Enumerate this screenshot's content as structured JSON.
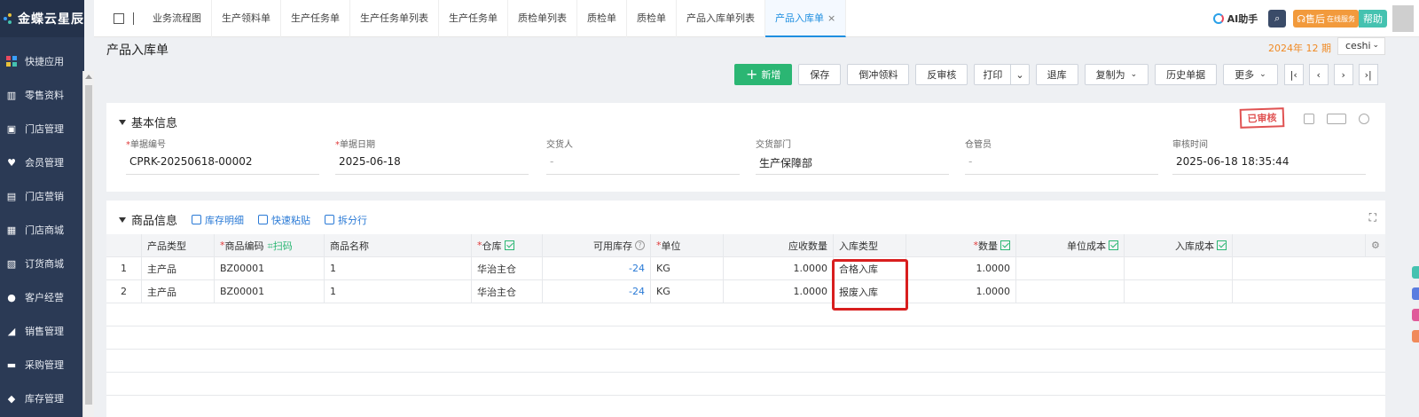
{
  "brand": {
    "logo_text": "金蝶云星辰"
  },
  "sidebar": {
    "items": [
      {
        "label": "快捷应用",
        "icon": "grid-icon"
      },
      {
        "label": "零售资料",
        "icon": "store-icon"
      },
      {
        "label": "门店管理",
        "icon": "shop-icon"
      },
      {
        "label": "会员管理",
        "icon": "heart-icon"
      },
      {
        "label": "门店营销",
        "icon": "bag-icon"
      },
      {
        "label": "门店商城",
        "icon": "mall-icon"
      },
      {
        "label": "订货商城",
        "icon": "calendar-icon"
      },
      {
        "label": "客户经营",
        "icon": "customer-icon"
      },
      {
        "label": "销售管理",
        "icon": "chart-icon"
      },
      {
        "label": "采购管理",
        "icon": "cart-icon"
      },
      {
        "label": "库存管理",
        "icon": "box-icon"
      }
    ]
  },
  "tabs": [
    {
      "label": "业务流程图"
    },
    {
      "label": "生产领料单"
    },
    {
      "label": "生产任务单"
    },
    {
      "label": "生产任务单列表"
    },
    {
      "label": "生产任务单"
    },
    {
      "label": "质检单列表"
    },
    {
      "label": "质检单"
    },
    {
      "label": "质检单"
    },
    {
      "label": "产品入库单列表"
    },
    {
      "label": "产品入库单",
      "active": true
    }
  ],
  "topright": {
    "ai_label": "AI助手",
    "service_label": "售后",
    "service_sub": "在线服务",
    "help_label": "帮助"
  },
  "page": {
    "title": "产品入库单",
    "period": "2024年 12 期",
    "user": "ceshi"
  },
  "toolbar": {
    "new": "新增",
    "save": "保存",
    "reverse": "倒冲领料",
    "unaudit": "反审核",
    "print": "打印",
    "return": "退库",
    "copy": "复制为",
    "history": "历史单据",
    "more": "更多"
  },
  "basic": {
    "title": "基本信息",
    "stamp": "已审核",
    "fields": [
      {
        "label": "单据编号",
        "required": true,
        "value": "CPRK-20250618-00002"
      },
      {
        "label": "单据日期",
        "required": true,
        "value": "2025-06-18"
      },
      {
        "label": "交货人",
        "required": false,
        "value": "-"
      },
      {
        "label": "交货部门",
        "required": false,
        "value": "生产保障部"
      },
      {
        "label": "仓管员",
        "required": false,
        "value": "-"
      },
      {
        "label": "审核时间",
        "required": false,
        "value": "2025-06-18 18:35:44"
      }
    ]
  },
  "goods": {
    "title": "商品信息",
    "links": [
      "库存明细",
      "快速粘贴",
      "拆分行"
    ],
    "scan_label": "扫码",
    "headers": {
      "type": "产品类型",
      "code": "商品编码",
      "name": "商品名称",
      "warehouse": "仓库",
      "stock": "可用库存",
      "unit": "单位",
      "recv_qty": "应收数量",
      "in_type": "入库类型",
      "qty": "数量",
      "unit_cost": "单位成本",
      "in_cost": "入库成本"
    },
    "rows": [
      {
        "no": "1",
        "type": "主产品",
        "code": "BZ00001",
        "name": "1",
        "warehouse": "华治主仓",
        "stock": "-24",
        "unit": "KG",
        "recv_qty": "1.0000",
        "in_type": "合格入库",
        "qty": "1.0000"
      },
      {
        "no": "2",
        "type": "主产品",
        "code": "BZ00001",
        "name": "1",
        "warehouse": "华治主仓",
        "stock": "-24",
        "unit": "KG",
        "recv_qty": "1.0000",
        "in_type": "报废入库",
        "qty": "1.0000"
      }
    ]
  },
  "colors": {
    "accent": "#1f8fe0",
    "primary_button": "#2bb673",
    "sidebar": "#2b3a55",
    "highlight": "#d81e1e"
  }
}
